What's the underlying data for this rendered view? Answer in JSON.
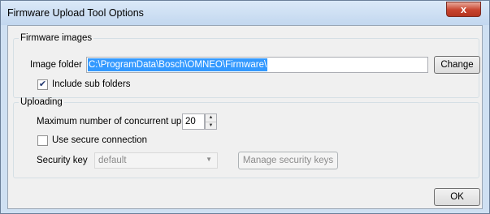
{
  "window": {
    "title": "Firmware Upload Tool Options",
    "close_glyph": "x"
  },
  "firmware": {
    "group_label": "Firmware images",
    "image_folder_label": "Image folder",
    "image_folder_value": "C:\\ProgramData\\Bosch\\OMNEO\\Firmware\\",
    "change_label": "Change",
    "include_sub_folders_label": "Include sub folders",
    "include_sub_folders_checked": true
  },
  "uploading": {
    "group_label": "Uploading",
    "max_uploads_label": "Maximum number of concurrent uploads",
    "max_uploads_value": "20",
    "secure_label": "Use secure connection",
    "secure_checked": false,
    "security_key_label": "Security key",
    "security_key_value": "default",
    "manage_keys_label": "Manage security keys"
  },
  "footer": {
    "ok_label": "OK"
  },
  "colors": {
    "accent_selection": "#3399ff",
    "title_bar": "#c2d7ef",
    "close_button": "#c7432d"
  }
}
